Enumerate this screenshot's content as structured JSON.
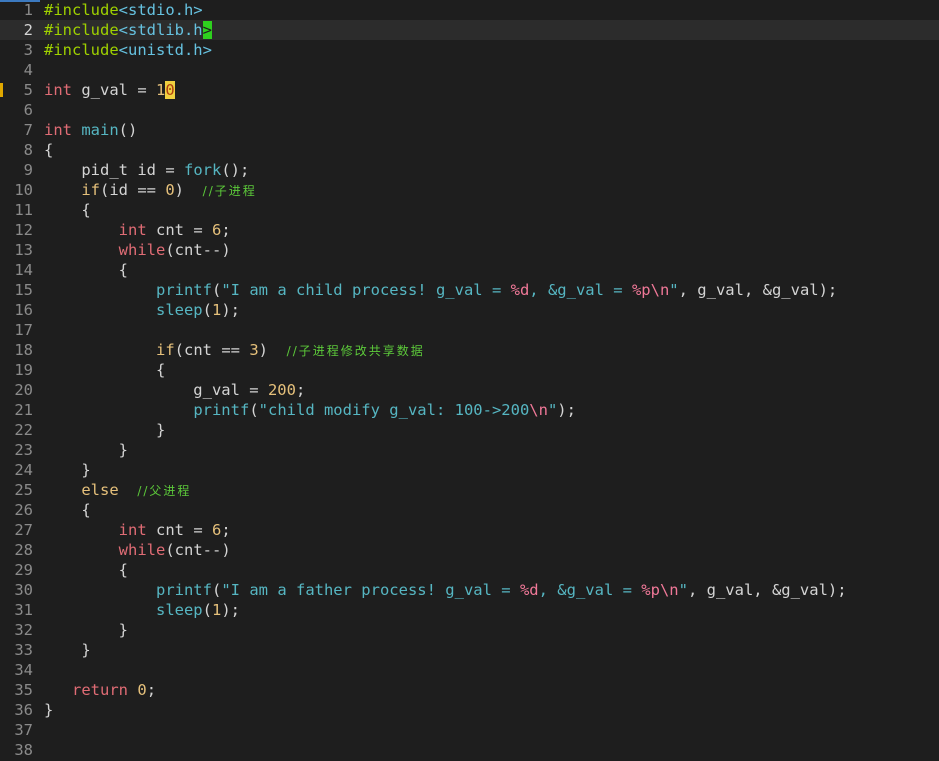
{
  "editor": {
    "current_line": 2,
    "marked_line": 5,
    "lines": [
      {
        "n": "1",
        "tokens": [
          {
            "t": "#include",
            "c": "pre"
          },
          {
            "t": "<stdio.h>",
            "c": "inc"
          }
        ]
      },
      {
        "n": "2",
        "tokens": [
          {
            "t": "#include",
            "c": "pre"
          },
          {
            "t": "<stdlib.h",
            "c": "inc"
          },
          {
            "t": ">",
            "c": "curg"
          }
        ]
      },
      {
        "n": "3",
        "tokens": [
          {
            "t": "#include",
            "c": "pre"
          },
          {
            "t": "<unistd.h>",
            "c": "inc"
          }
        ]
      },
      {
        "n": "4",
        "tokens": []
      },
      {
        "n": "5",
        "tokens": [
          {
            "t": "int",
            "c": "type"
          },
          {
            "t": " g_val = ",
            "c": "plain"
          },
          {
            "t": "1",
            "c": "num"
          },
          {
            "t": "0",
            "c": "cury"
          }
        ]
      },
      {
        "n": "6",
        "tokens": []
      },
      {
        "n": "7",
        "tokens": [
          {
            "t": "int",
            "c": "type"
          },
          {
            "t": " ",
            "c": "plain"
          },
          {
            "t": "main",
            "c": "fn"
          },
          {
            "t": "()",
            "c": "plain"
          }
        ]
      },
      {
        "n": "8",
        "tokens": [
          {
            "t": "{",
            "c": "plain"
          }
        ]
      },
      {
        "n": "9",
        "tokens": [
          {
            "t": "    pid_t id = ",
            "c": "plain"
          },
          {
            "t": "fork",
            "c": "fn"
          },
          {
            "t": "();",
            "c": "plain"
          }
        ]
      },
      {
        "n": "10",
        "tokens": [
          {
            "t": "    ",
            "c": "plain"
          },
          {
            "t": "if",
            "c": "ctl"
          },
          {
            "t": "(id == ",
            "c": "plain"
          },
          {
            "t": "0",
            "c": "num"
          },
          {
            "t": ")  ",
            "c": "plain"
          },
          {
            "t": "//子进程",
            "c": "com"
          }
        ]
      },
      {
        "n": "11",
        "tokens": [
          {
            "t": "    {",
            "c": "plain"
          }
        ]
      },
      {
        "n": "12",
        "tokens": [
          {
            "t": "        ",
            "c": "plain"
          },
          {
            "t": "int",
            "c": "type"
          },
          {
            "t": " cnt = ",
            "c": "plain"
          },
          {
            "t": "6",
            "c": "num"
          },
          {
            "t": ";",
            "c": "plain"
          }
        ]
      },
      {
        "n": "13",
        "tokens": [
          {
            "t": "        ",
            "c": "plain"
          },
          {
            "t": "while",
            "c": "kw"
          },
          {
            "t": "(cnt--)",
            "c": "plain"
          }
        ]
      },
      {
        "n": "14",
        "tokens": [
          {
            "t": "        {",
            "c": "plain"
          }
        ]
      },
      {
        "n": "15",
        "tokens": [
          {
            "t": "            ",
            "c": "plain"
          },
          {
            "t": "printf",
            "c": "fn"
          },
          {
            "t": "(",
            "c": "plain"
          },
          {
            "t": "\"I am a child process! g_val = ",
            "c": "str"
          },
          {
            "t": "%d",
            "c": "fmt"
          },
          {
            "t": ", &g_val = ",
            "c": "str"
          },
          {
            "t": "%p\\n",
            "c": "fmt"
          },
          {
            "t": "\"",
            "c": "str"
          },
          {
            "t": ", g_val, &g_val);",
            "c": "plain"
          }
        ]
      },
      {
        "n": "16",
        "tokens": [
          {
            "t": "            ",
            "c": "plain"
          },
          {
            "t": "sleep",
            "c": "fn"
          },
          {
            "t": "(",
            "c": "plain"
          },
          {
            "t": "1",
            "c": "num"
          },
          {
            "t": ");",
            "c": "plain"
          }
        ]
      },
      {
        "n": "17",
        "tokens": []
      },
      {
        "n": "18",
        "tokens": [
          {
            "t": "            ",
            "c": "plain"
          },
          {
            "t": "if",
            "c": "ctl"
          },
          {
            "t": "(cnt == ",
            "c": "plain"
          },
          {
            "t": "3",
            "c": "num"
          },
          {
            "t": ")  ",
            "c": "plain"
          },
          {
            "t": "//子进程修改共享数据",
            "c": "com"
          }
        ]
      },
      {
        "n": "19",
        "tokens": [
          {
            "t": "            {",
            "c": "plain"
          }
        ]
      },
      {
        "n": "20",
        "tokens": [
          {
            "t": "                g_val = ",
            "c": "plain"
          },
          {
            "t": "200",
            "c": "num"
          },
          {
            "t": ";",
            "c": "plain"
          }
        ]
      },
      {
        "n": "21",
        "tokens": [
          {
            "t": "                ",
            "c": "plain"
          },
          {
            "t": "printf",
            "c": "fn"
          },
          {
            "t": "(",
            "c": "plain"
          },
          {
            "t": "\"child modify g_val: 100->200",
            "c": "str"
          },
          {
            "t": "\\n",
            "c": "fmt"
          },
          {
            "t": "\"",
            "c": "str"
          },
          {
            "t": ");",
            "c": "plain"
          }
        ]
      },
      {
        "n": "22",
        "tokens": [
          {
            "t": "            }",
            "c": "plain"
          }
        ]
      },
      {
        "n": "23",
        "tokens": [
          {
            "t": "        }",
            "c": "plain"
          }
        ]
      },
      {
        "n": "24",
        "tokens": [
          {
            "t": "    }",
            "c": "plain"
          }
        ]
      },
      {
        "n": "25",
        "tokens": [
          {
            "t": "    ",
            "c": "plain"
          },
          {
            "t": "else",
            "c": "ctl"
          },
          {
            "t": "  ",
            "c": "plain"
          },
          {
            "t": "//父进程",
            "c": "com"
          }
        ]
      },
      {
        "n": "26",
        "tokens": [
          {
            "t": "    {",
            "c": "plain"
          }
        ]
      },
      {
        "n": "27",
        "tokens": [
          {
            "t": "        ",
            "c": "plain"
          },
          {
            "t": "int",
            "c": "type"
          },
          {
            "t": " cnt = ",
            "c": "plain"
          },
          {
            "t": "6",
            "c": "num"
          },
          {
            "t": ";",
            "c": "plain"
          }
        ]
      },
      {
        "n": "28",
        "tokens": [
          {
            "t": "        ",
            "c": "plain"
          },
          {
            "t": "while",
            "c": "kw"
          },
          {
            "t": "(cnt--)",
            "c": "plain"
          }
        ]
      },
      {
        "n": "29",
        "tokens": [
          {
            "t": "        {",
            "c": "plain"
          }
        ]
      },
      {
        "n": "30",
        "tokens": [
          {
            "t": "            ",
            "c": "plain"
          },
          {
            "t": "printf",
            "c": "fn"
          },
          {
            "t": "(",
            "c": "plain"
          },
          {
            "t": "\"I am a father process! g_val = ",
            "c": "str"
          },
          {
            "t": "%d",
            "c": "fmt"
          },
          {
            "t": ", &g_val = ",
            "c": "str"
          },
          {
            "t": "%p\\n",
            "c": "fmt"
          },
          {
            "t": "\"",
            "c": "str"
          },
          {
            "t": ", g_val, &g_val);",
            "c": "plain"
          }
        ]
      },
      {
        "n": "31",
        "tokens": [
          {
            "t": "            ",
            "c": "plain"
          },
          {
            "t": "sleep",
            "c": "fn"
          },
          {
            "t": "(",
            "c": "plain"
          },
          {
            "t": "1",
            "c": "num"
          },
          {
            "t": ");",
            "c": "plain"
          }
        ]
      },
      {
        "n": "32",
        "tokens": [
          {
            "t": "        }",
            "c": "plain"
          }
        ]
      },
      {
        "n": "33",
        "tokens": [
          {
            "t": "    }",
            "c": "plain"
          }
        ]
      },
      {
        "n": "34",
        "tokens": []
      },
      {
        "n": "35",
        "tokens": [
          {
            "t": "   ",
            "c": "plain"
          },
          {
            "t": "return",
            "c": "kw"
          },
          {
            "t": " ",
            "c": "plain"
          },
          {
            "t": "0",
            "c": "num"
          },
          {
            "t": ";",
            "c": "plain"
          }
        ]
      },
      {
        "n": "36",
        "tokens": [
          {
            "t": "}",
            "c": "plain"
          }
        ]
      },
      {
        "n": "37",
        "tokens": []
      },
      {
        "n": "38",
        "tokens": []
      }
    ]
  }
}
